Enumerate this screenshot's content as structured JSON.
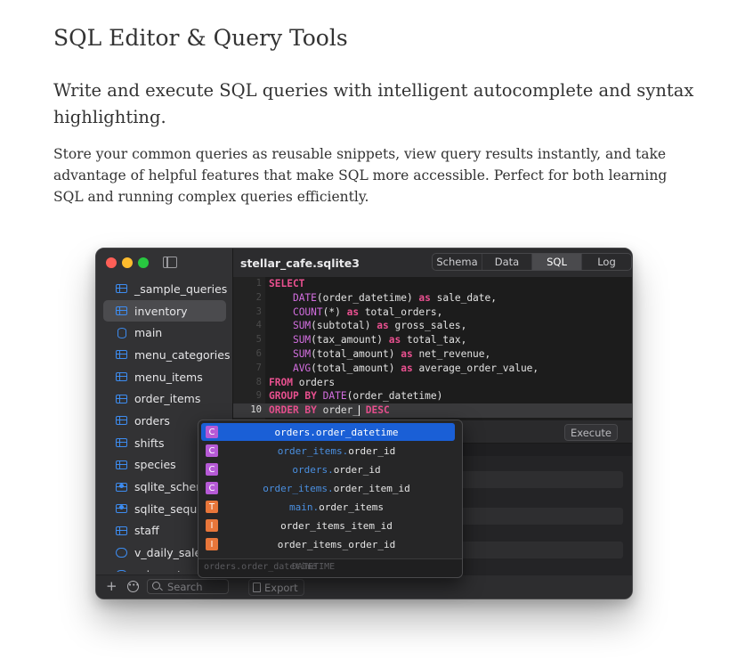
{
  "doc": {
    "title": "SQL Editor & Query Tools",
    "lead": "Write and execute SQL queries with intelligent autocomplete and syntax highlighting.",
    "body": "Store your common queries as reusable snippets, view query results instantly, and take advantage of helpful features that make SQL more accessible. Perfect for both learning SQL and running complex queries efficiently."
  },
  "window": {
    "title": "stellar_cafe.sqlite3",
    "tabs": [
      "Schema",
      "Data",
      "SQL",
      "Log"
    ],
    "active_tab": "SQL"
  },
  "sidebar": {
    "items": [
      {
        "label": "_sample_queries",
        "icon": "table-icon"
      },
      {
        "label": "inventory",
        "icon": "table-icon",
        "selected": true
      },
      {
        "label": "main",
        "icon": "database-icon"
      },
      {
        "label": "menu_categories",
        "icon": "table-icon"
      },
      {
        "label": "menu_items",
        "icon": "table-icon"
      },
      {
        "label": "order_items",
        "icon": "table-icon"
      },
      {
        "label": "orders",
        "icon": "table-icon"
      },
      {
        "label": "shifts",
        "icon": "table-icon"
      },
      {
        "label": "species",
        "icon": "table-icon"
      },
      {
        "label": "sqlite_schema",
        "icon": "system-table-icon"
      },
      {
        "label": "sqlite_sequence",
        "icon": "system-table-icon"
      },
      {
        "label": "staff",
        "icon": "table-icon"
      },
      {
        "label": "v_daily_sales",
        "icon": "view-icon"
      },
      {
        "label": "v_inventory_s",
        "icon": "view-icon"
      }
    ],
    "footer": {
      "add": "+",
      "more": "•••",
      "search_placeholder": "Search"
    }
  },
  "editor": {
    "line_numbers": [
      "1",
      "2",
      "3",
      "4",
      "5",
      "6",
      "7",
      "8",
      "9",
      "10"
    ],
    "current_line": 10
  },
  "toolbar": {
    "execute_label": "Execute",
    "export_label": "Export"
  },
  "autocomplete": {
    "items": [
      {
        "kind": "C",
        "prefix": "orders.",
        "name": "order_datetime",
        "selected": true
      },
      {
        "kind": "C",
        "prefix": "order_items.",
        "name": "order_id"
      },
      {
        "kind": "C",
        "prefix": "orders.",
        "name": "order_id"
      },
      {
        "kind": "C",
        "prefix": "order_items.",
        "name": "order_item_id"
      },
      {
        "kind": "T",
        "prefix": "main.",
        "name": "order_items"
      },
      {
        "kind": "I",
        "prefix": "",
        "name": "order_items_item_id"
      },
      {
        "kind": "I",
        "prefix": "",
        "name": "order_items_order_id"
      }
    ],
    "footer_left": "orders.order_datetime",
    "footer_right": "DATETIME"
  },
  "colors": {
    "keyword": "#e8508f",
    "function": "#d36ee0",
    "accent": "#1a5fd6",
    "column_badge": "#b65ad6",
    "table_badge": "#e8763a"
  }
}
